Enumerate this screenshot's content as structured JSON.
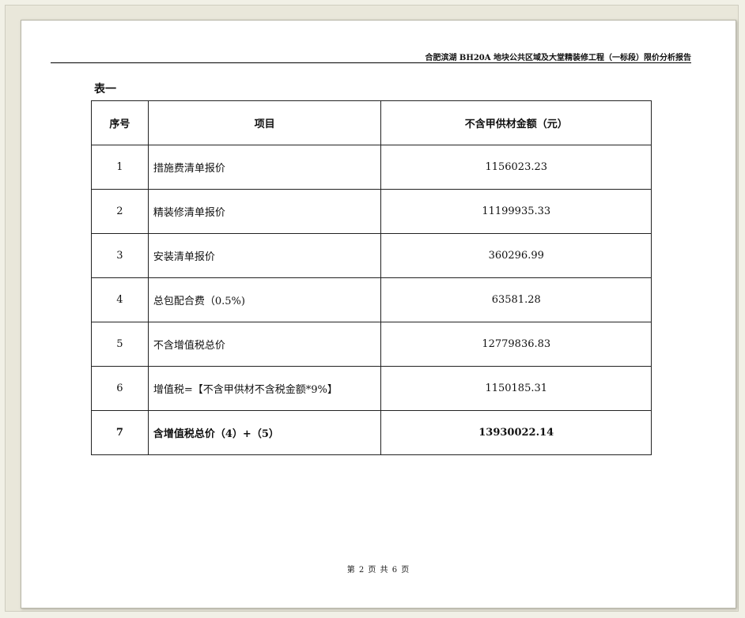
{
  "header": {
    "title": "合肥滨湖 BH20A 地块公共区域及大堂精装修工程（一标段）限价分析报告"
  },
  "table": {
    "caption": "表一",
    "columns": [
      "序号",
      "项目",
      "不含甲供材金额（元）"
    ],
    "rows": [
      {
        "no": "1",
        "item": "措施费清单报价",
        "amount": "1156023.23"
      },
      {
        "no": "2",
        "item": "精装修清单报价",
        "amount": "11199935.33"
      },
      {
        "no": "3",
        "item": "安装清单报价",
        "amount": "360296.99"
      },
      {
        "no": "4",
        "item": "总包配合费（0.5%)",
        "amount": "63581.28"
      },
      {
        "no": "5",
        "item": "不含增值税总价",
        "amount": "12779836.83"
      },
      {
        "no": "6",
        "item": "增值税=【不含甲供材不含税金额*9%】",
        "amount": "1150185.31"
      },
      {
        "no": "7",
        "item": "含增值税总价（4）+（5）",
        "amount": "13930022.14"
      }
    ]
  },
  "footer": {
    "page_indicator": "第 2 页 共 6 页"
  }
}
